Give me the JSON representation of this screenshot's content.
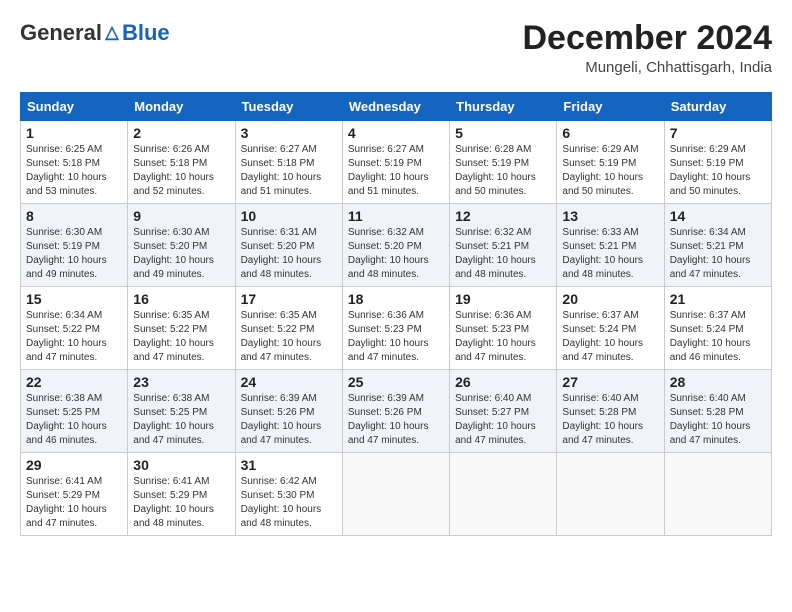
{
  "header": {
    "logo": {
      "general": "General",
      "blue": "Blue",
      "tagline": ""
    },
    "title": "December 2024",
    "location": "Mungeli, Chhattisgarh, India"
  },
  "calendar": {
    "days_of_week": [
      "Sunday",
      "Monday",
      "Tuesday",
      "Wednesday",
      "Thursday",
      "Friday",
      "Saturday"
    ],
    "weeks": [
      [
        {
          "day": "",
          "info": ""
        },
        {
          "day": "2",
          "info": "Sunrise: 6:26 AM\nSunset: 5:18 PM\nDaylight: 10 hours\nand 52 minutes."
        },
        {
          "day": "3",
          "info": "Sunrise: 6:27 AM\nSunset: 5:18 PM\nDaylight: 10 hours\nand 51 minutes."
        },
        {
          "day": "4",
          "info": "Sunrise: 6:27 AM\nSunset: 5:19 PM\nDaylight: 10 hours\nand 51 minutes."
        },
        {
          "day": "5",
          "info": "Sunrise: 6:28 AM\nSunset: 5:19 PM\nDaylight: 10 hours\nand 50 minutes."
        },
        {
          "day": "6",
          "info": "Sunrise: 6:29 AM\nSunset: 5:19 PM\nDaylight: 10 hours\nand 50 minutes."
        },
        {
          "day": "7",
          "info": "Sunrise: 6:29 AM\nSunset: 5:19 PM\nDaylight: 10 hours\nand 50 minutes."
        }
      ],
      [
        {
          "day": "1",
          "info": "Sunrise: 6:25 AM\nSunset: 5:18 PM\nDaylight: 10 hours\nand 53 minutes."
        },
        {
          "day": "",
          "info": ""
        },
        {
          "day": "",
          "info": ""
        },
        {
          "day": "",
          "info": ""
        },
        {
          "day": "",
          "info": ""
        },
        {
          "day": "",
          "info": ""
        },
        {
          "day": ""
        }
      ],
      [
        {
          "day": "8",
          "info": "Sunrise: 6:30 AM\nSunset: 5:19 PM\nDaylight: 10 hours\nand 49 minutes."
        },
        {
          "day": "9",
          "info": "Sunrise: 6:30 AM\nSunset: 5:20 PM\nDaylight: 10 hours\nand 49 minutes."
        },
        {
          "day": "10",
          "info": "Sunrise: 6:31 AM\nSunset: 5:20 PM\nDaylight: 10 hours\nand 48 minutes."
        },
        {
          "day": "11",
          "info": "Sunrise: 6:32 AM\nSunset: 5:20 PM\nDaylight: 10 hours\nand 48 minutes."
        },
        {
          "day": "12",
          "info": "Sunrise: 6:32 AM\nSunset: 5:21 PM\nDaylight: 10 hours\nand 48 minutes."
        },
        {
          "day": "13",
          "info": "Sunrise: 6:33 AM\nSunset: 5:21 PM\nDaylight: 10 hours\nand 48 minutes."
        },
        {
          "day": "14",
          "info": "Sunrise: 6:34 AM\nSunset: 5:21 PM\nDaylight: 10 hours\nand 47 minutes."
        }
      ],
      [
        {
          "day": "15",
          "info": "Sunrise: 6:34 AM\nSunset: 5:22 PM\nDaylight: 10 hours\nand 47 minutes."
        },
        {
          "day": "16",
          "info": "Sunrise: 6:35 AM\nSunset: 5:22 PM\nDaylight: 10 hours\nand 47 minutes."
        },
        {
          "day": "17",
          "info": "Sunrise: 6:35 AM\nSunset: 5:22 PM\nDaylight: 10 hours\nand 47 minutes."
        },
        {
          "day": "18",
          "info": "Sunrise: 6:36 AM\nSunset: 5:23 PM\nDaylight: 10 hours\nand 47 minutes."
        },
        {
          "day": "19",
          "info": "Sunrise: 6:36 AM\nSunset: 5:23 PM\nDaylight: 10 hours\nand 47 minutes."
        },
        {
          "day": "20",
          "info": "Sunrise: 6:37 AM\nSunset: 5:24 PM\nDaylight: 10 hours\nand 47 minutes."
        },
        {
          "day": "21",
          "info": "Sunrise: 6:37 AM\nSunset: 5:24 PM\nDaylight: 10 hours\nand 46 minutes."
        }
      ],
      [
        {
          "day": "22",
          "info": "Sunrise: 6:38 AM\nSunset: 5:25 PM\nDaylight: 10 hours\nand 46 minutes."
        },
        {
          "day": "23",
          "info": "Sunrise: 6:38 AM\nSunset: 5:25 PM\nDaylight: 10 hours\nand 47 minutes."
        },
        {
          "day": "24",
          "info": "Sunrise: 6:39 AM\nSunset: 5:26 PM\nDaylight: 10 hours\nand 47 minutes."
        },
        {
          "day": "25",
          "info": "Sunrise: 6:39 AM\nSunset: 5:26 PM\nDaylight: 10 hours\nand 47 minutes."
        },
        {
          "day": "26",
          "info": "Sunrise: 6:40 AM\nSunset: 5:27 PM\nDaylight: 10 hours\nand 47 minutes."
        },
        {
          "day": "27",
          "info": "Sunrise: 6:40 AM\nSunset: 5:28 PM\nDaylight: 10 hours\nand 47 minutes."
        },
        {
          "day": "28",
          "info": "Sunrise: 6:40 AM\nSunset: 5:28 PM\nDaylight: 10 hours\nand 47 minutes."
        }
      ],
      [
        {
          "day": "29",
          "info": "Sunrise: 6:41 AM\nSunset: 5:29 PM\nDaylight: 10 hours\nand 47 minutes."
        },
        {
          "day": "30",
          "info": "Sunrise: 6:41 AM\nSunset: 5:29 PM\nDaylight: 10 hours\nand 48 minutes."
        },
        {
          "day": "31",
          "info": "Sunrise: 6:42 AM\nSunset: 5:30 PM\nDaylight: 10 hours\nand 48 minutes."
        },
        {
          "day": "",
          "info": ""
        },
        {
          "day": "",
          "info": ""
        },
        {
          "day": "",
          "info": ""
        },
        {
          "day": "",
          "info": ""
        }
      ]
    ]
  }
}
